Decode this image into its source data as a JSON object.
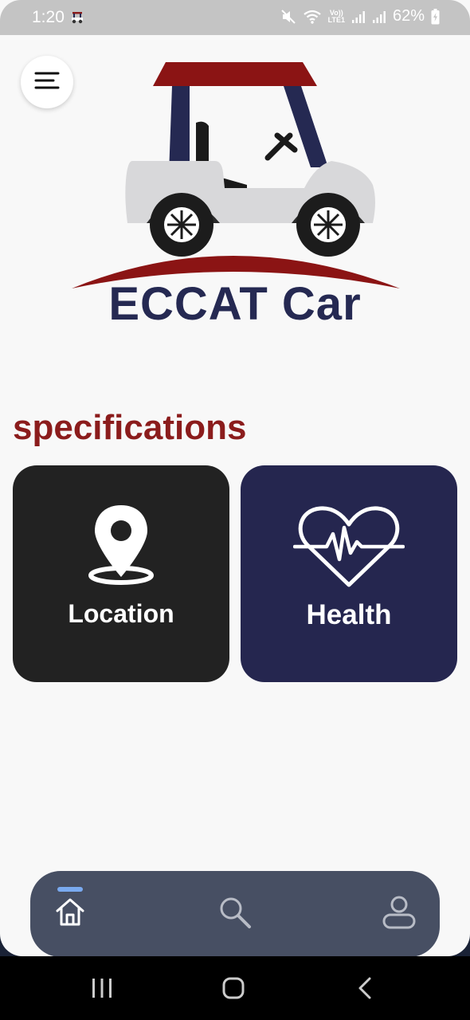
{
  "status_bar": {
    "time": "1:20",
    "lte_top": "Vo))",
    "lte_bottom": "LTE1",
    "battery": "62%",
    "app_icon": "golf-cart-icon",
    "icons": [
      "mute-icon",
      "wifi-icon",
      "signal-icon",
      "signal-icon",
      "battery-icon"
    ]
  },
  "header": {
    "menu_icon": "menu-icon",
    "logo_text": "ECCAT Car"
  },
  "main": {
    "section_title": "specifications",
    "cards": [
      {
        "label": "Location",
        "icon": "location-pin-icon",
        "color": "#222222"
      },
      {
        "label": "Health",
        "icon": "heart-pulse-icon",
        "color": "#25264f"
      }
    ]
  },
  "bottom_nav": {
    "items": [
      {
        "icon": "home-icon",
        "active": true
      },
      {
        "icon": "search-icon",
        "active": false
      },
      {
        "icon": "profile-icon",
        "active": false
      }
    ],
    "background": "#474f63",
    "indicator_color": "#7aaaf0"
  },
  "system_nav": {
    "buttons": [
      "recent-apps-icon",
      "home-circle-icon",
      "back-icon"
    ]
  },
  "colors": {
    "accent_red": "#8b1c1c",
    "brand_navy": "#252952"
  }
}
